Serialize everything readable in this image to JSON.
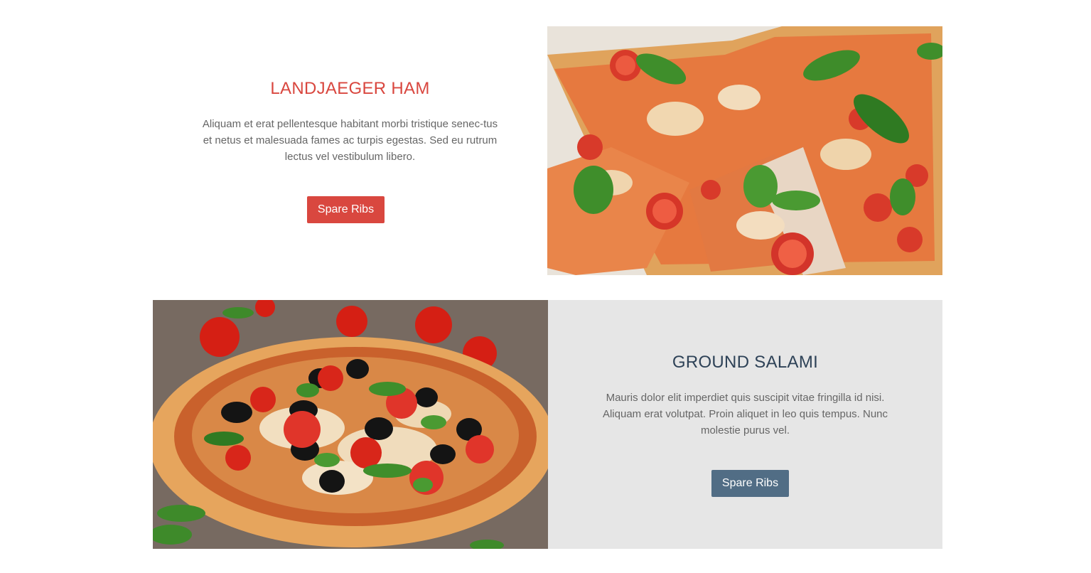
{
  "sections": [
    {
      "title": "LANDJAEGER HAM",
      "description": "Aliquam et erat pellentesque habitant morbi tristique senec-tus et netus et malesuada fames ac turpis egestas. Sed eu rutrum lectus vel vestibulum libero.",
      "button_label": "Spare Ribs",
      "image_alt": "pizza slices with basil and tomato"
    },
    {
      "title": "GROUND SALAMI",
      "description": "Mauris dolor elit imperdiet quis suscipit vitae fringilla id nisi. Aliquam erat volutpat. Proin aliquet in leo quis tempus. Nunc molestie purus vel.",
      "button_label": "Spare Ribs",
      "image_alt": "whole pizza with olives and tomatoes on wooden table"
    }
  ],
  "colors": {
    "accent_red": "#d9473f",
    "accent_slate": "#516d85",
    "title_dark": "#2e4257",
    "panel_grey": "#e6e6e6"
  }
}
